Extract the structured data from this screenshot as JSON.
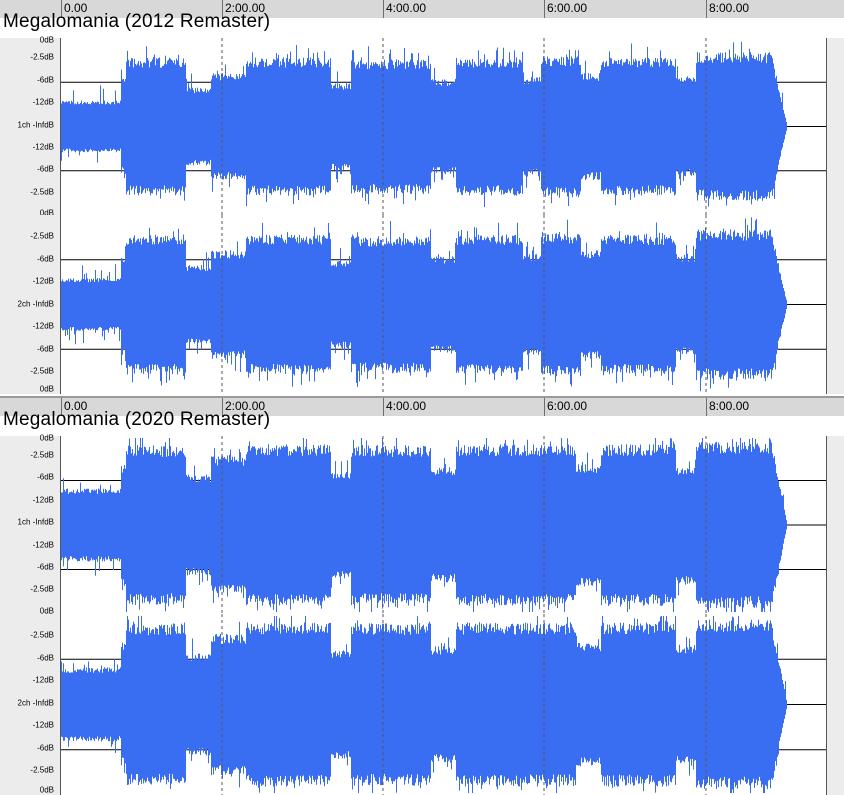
{
  "ruler": {
    "labels": [
      "0.00",
      "2:00.00",
      "4:00.00",
      "6:00.00",
      "8:00.00"
    ]
  },
  "tracks": [
    {
      "title": "Megalomania (2012 Remaster)",
      "channels": [
        {
          "label": "1ch -InfdB",
          "scale": [
            "0dB",
            "-2.5dB",
            "-6dB",
            "-12dB",
            "1ch -InfdB",
            "-12dB",
            "-6dB",
            "-2.5dB",
            "0dB"
          ]
        },
        {
          "label": "2ch -InfdB",
          "scale": [
            "0dB",
            "-2.5dB",
            "-6dB",
            "-12dB",
            "2ch -InfdB",
            "-12dB",
            "-6dB",
            "-2.5dB",
            "0dB"
          ]
        }
      ]
    },
    {
      "title": "Megalomania (2020 Remaster)",
      "channels": [
        {
          "label": "1ch -InfdB",
          "scale": [
            "0dB",
            "-2.5dB",
            "-6dB",
            "-12dB",
            "1ch -InfdB",
            "-12dB",
            "-6dB",
            "-2.5dB",
            "0dB"
          ]
        },
        {
          "label": "2ch -InfdB",
          "scale": [
            "0dB",
            "-2.5dB",
            "-6dB",
            "-12dB",
            "2ch -InfdB",
            "-12dB",
            "-6dB",
            "-2.5dB",
            "0dB"
          ]
        }
      ]
    }
  ],
  "colors": {
    "waveform": "#3a6ef2",
    "ruler_bg": "#d8d8d8",
    "scale_bg": "#ececec"
  }
}
